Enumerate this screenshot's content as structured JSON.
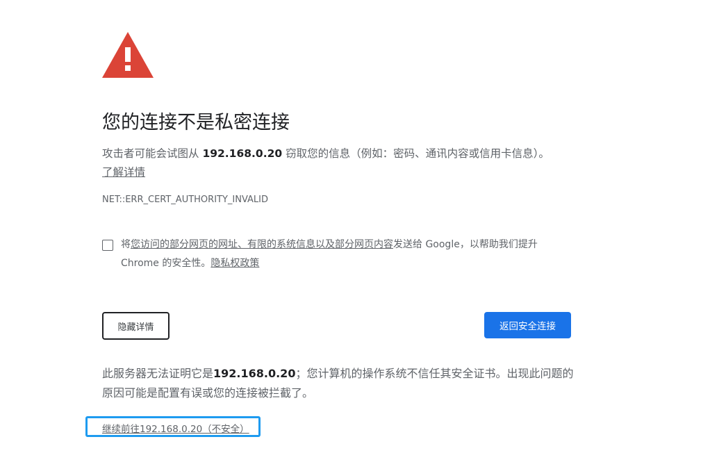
{
  "icon": "warning-triangle-icon",
  "title": "您的连接不是私密连接",
  "description": {
    "prefix": "攻击者可能会试图从 ",
    "host": "192.168.0.20",
    "suffix": " 窃取您的信息（例如：密码、通讯内容或信用卡信息）。",
    "learn_more": "了解详情"
  },
  "error_code": "NET::ERR_CERT_AUTHORITY_INVALID",
  "optin": {
    "prefix": "将",
    "link": "您访问的部分网页的网址、有限的系统信息以及部分网页内容",
    "middle": "发送给 Google，以帮助我们提升 Chrome 的安全性。",
    "privacy_link": "隐私权政策"
  },
  "buttons": {
    "hide_details": "隐藏详情",
    "back_to_safety": "返回安全连接"
  },
  "details": {
    "prefix": "此服务器无法证明它是",
    "host": "192.168.0.20",
    "suffix": "；您计算机的操作系统不信任其安全证书。出现此问题的原因可能是配置有误或您的连接被拦截了。"
  },
  "proceed_link": "继续前往192.168.0.20（不安全）",
  "colors": {
    "primary_button": "#1a73e8",
    "warning_red": "#db4437",
    "highlight": "#1e9bf0"
  }
}
